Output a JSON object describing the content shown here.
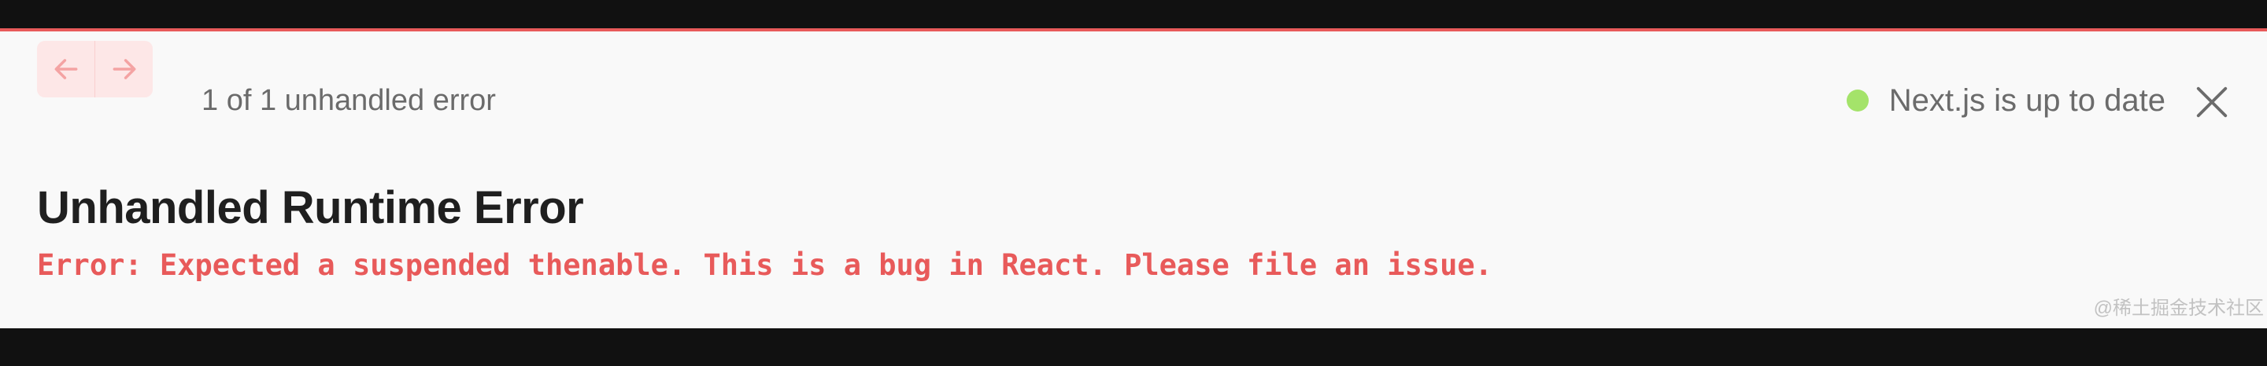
{
  "header": {
    "error_count_text": "1 of 1 unhandled error",
    "status_text": "Next.js is up to date"
  },
  "error": {
    "title": "Unhandled Runtime Error",
    "message": "Error: Expected a suspended thenable. This is a bug in React. Please file an issue."
  },
  "watermark": "@稀土掘金技术社区",
  "icons": {
    "prev": "arrow-left-icon",
    "next": "arrow-right-icon",
    "close": "close-icon",
    "status": "status-dot-icon"
  },
  "colors": {
    "accent": "#e85a5a",
    "status_ok": "#a4e36a",
    "nav_bg": "#fde7e7"
  }
}
